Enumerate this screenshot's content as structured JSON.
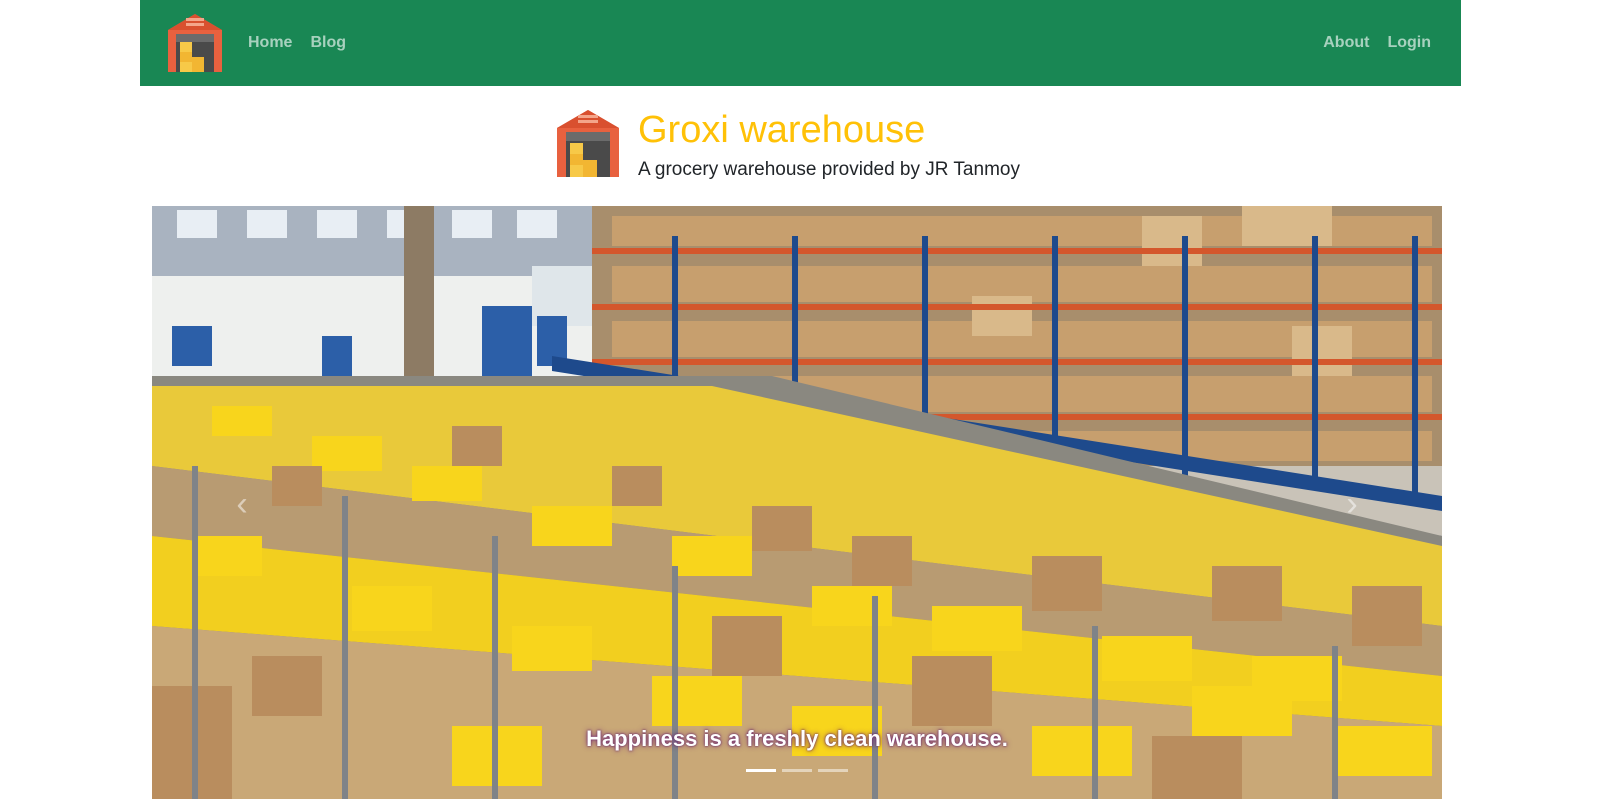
{
  "navbar": {
    "logo_icon": "warehouse-icon",
    "left_links": [
      {
        "label": "Home"
      },
      {
        "label": "Blog"
      }
    ],
    "right_links": [
      {
        "label": "About"
      },
      {
        "label": "Login"
      }
    ],
    "background_color": "#198754"
  },
  "header": {
    "logo_icon": "warehouse-icon",
    "title": "Groxi warehouse",
    "subtitle": "A grocery warehouse provided by JR Tanmoy",
    "title_color": "#ffc107"
  },
  "carousel": {
    "image_icon": "warehouse-photo",
    "caption": "Happiness is a freshly clean warehouse.",
    "prev_icon": "chevron-left-icon",
    "next_icon": "chevron-right-icon",
    "indicator_count": 3,
    "active_index": 0
  }
}
